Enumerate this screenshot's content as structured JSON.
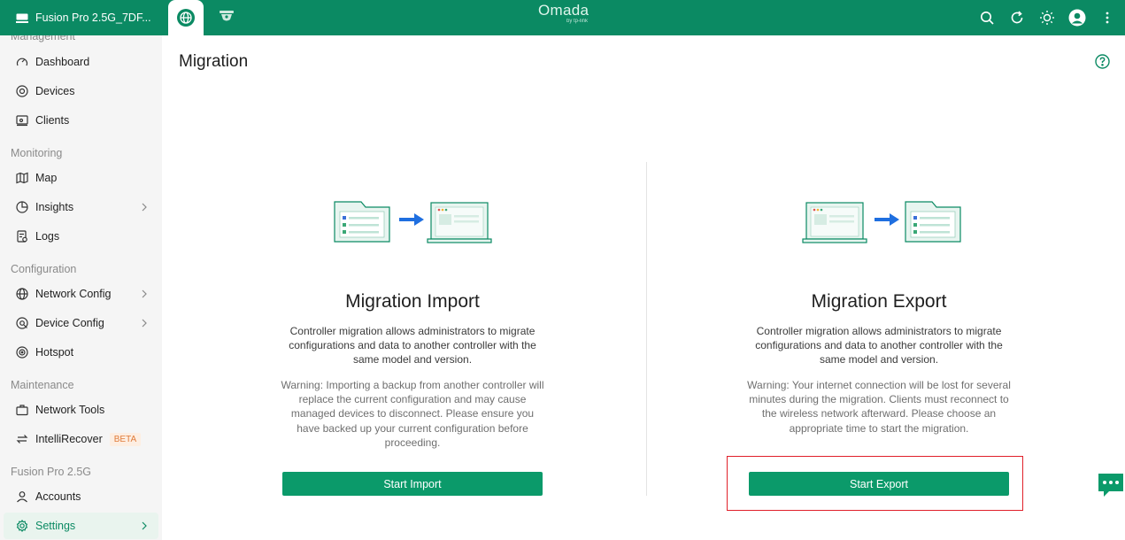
{
  "topbar": {
    "site_name": "Fusion Pro 2.5G_7DF...",
    "brand": "Omada",
    "brand_sub": "by tp-link",
    "icons": [
      "search-icon",
      "refresh-icon",
      "theme-icon",
      "avatar",
      "more-icon"
    ]
  },
  "sidebar": {
    "group_top": "Management",
    "dashboard": "Dashboard",
    "devices": "Devices",
    "clients": "Clients",
    "group_monitoring": "Monitoring",
    "map": "Map",
    "insights": "Insights",
    "logs": "Logs",
    "group_configuration": "Configuration",
    "network_config": "Network Config",
    "device_config": "Device Config",
    "hotspot": "Hotspot",
    "group_maintenance": "Maintenance",
    "network_tools": "Network Tools",
    "intellirecover": "IntelliRecover",
    "beta_badge": "BETA",
    "group_device": "Fusion Pro 2.5G",
    "accounts": "Accounts",
    "settings": "Settings"
  },
  "page": {
    "title": "Migration"
  },
  "import_card": {
    "title": "Migration Import",
    "description": "Controller migration allows administrators to migrate configurations and data to another controller with the same model and version.",
    "warning": "Warning: Importing a backup from another controller will replace the current configuration and may cause managed devices to disconnect. Please ensure you have backed up your current configuration before proceeding.",
    "button": "Start Import"
  },
  "export_card": {
    "title": "Migration Export",
    "description": "Controller migration allows administrators to migrate configurations and data to another controller with the same model and version.",
    "warning": "Warning: Your internet connection will be lost for several minutes during the migration. Clients must reconnect to the wireless network afterward. Please choose an appropriate time to start the migration.",
    "button": "Start Export"
  },
  "colors": {
    "brand": "#0b8a63",
    "button": "#0b9a6a",
    "highlight": "#e0202a"
  }
}
